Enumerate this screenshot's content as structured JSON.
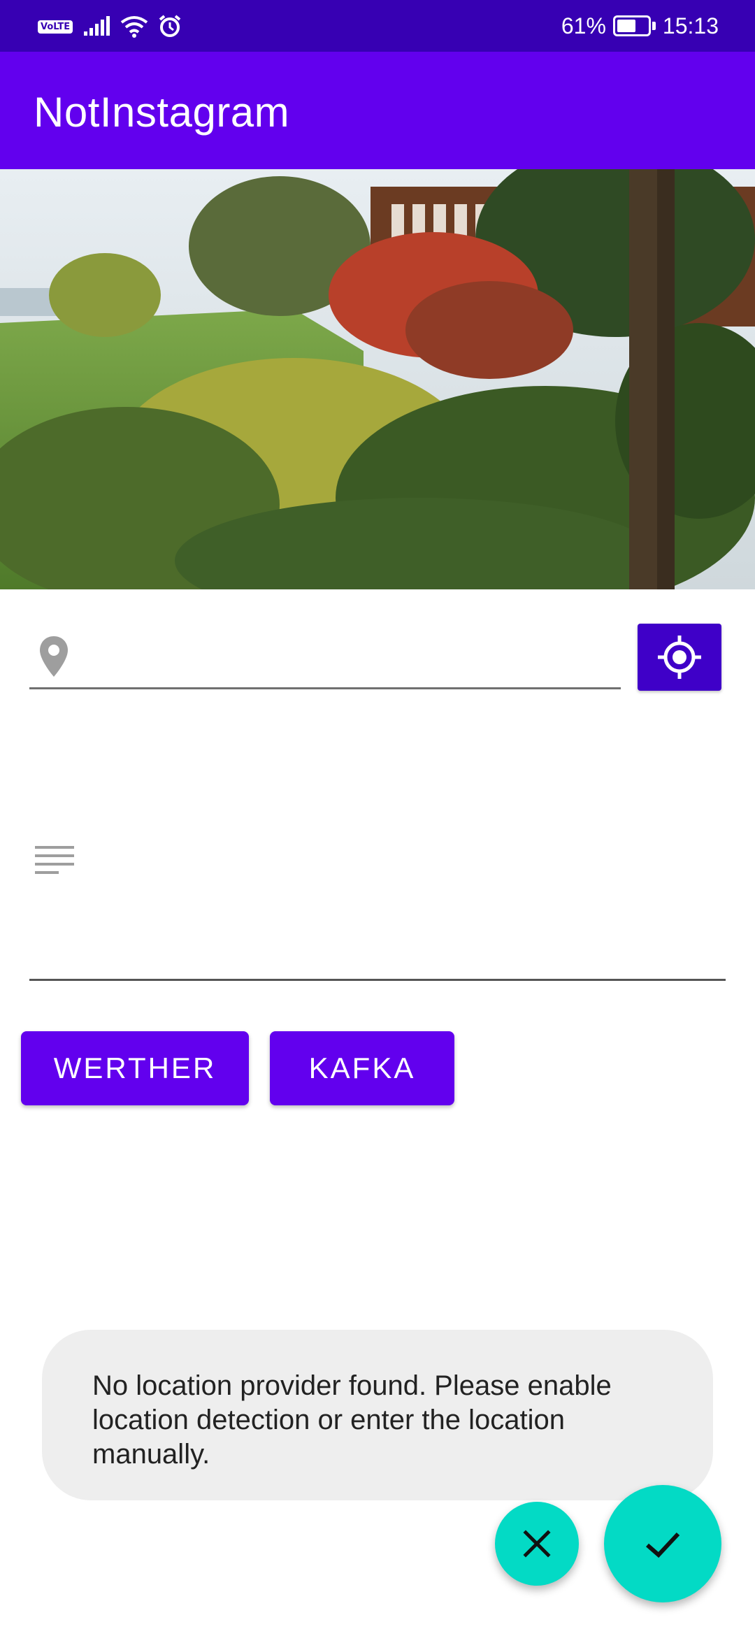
{
  "status_bar": {
    "volte": "VoLTE",
    "battery": "61%",
    "battery_level": 0.61,
    "time": "15:13",
    "icons": [
      "volte-icon",
      "signal-icon",
      "wifi-icon",
      "alarm-icon",
      "battery-charging-icon"
    ]
  },
  "app_bar": {
    "title": "NotInstagram"
  },
  "photo": {
    "description_icon": "photo-image"
  },
  "location": {
    "value": "",
    "placeholder": "",
    "icon": "location-pin-icon",
    "button_icon": "gps-crosshair-icon"
  },
  "description": {
    "value": "",
    "placeholder": "",
    "icon": "notes-icon"
  },
  "filters": {
    "werther": "WERTHER",
    "kafka": "KAFKA"
  },
  "toast": {
    "message": "No location provider found. Please enable location detection or enter the location manually."
  },
  "fabs": {
    "cancel_icon": "close-icon",
    "confirm_icon": "check-icon"
  },
  "colors": {
    "status_bar": "#3700b3",
    "primary": "#6200ee",
    "primary_dark": "#3f00c8",
    "accent": "#03dac5",
    "toast_bg": "#eeeeee"
  }
}
